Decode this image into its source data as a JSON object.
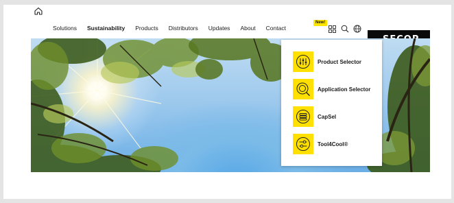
{
  "nav": {
    "home_icon": "home-icon",
    "links": [
      {
        "label": "Solutions",
        "active": false
      },
      {
        "label": "Sustainability",
        "active": true
      },
      {
        "label": "Products",
        "active": false
      },
      {
        "label": "Distributors",
        "active": false
      },
      {
        "label": "Updates",
        "active": false
      },
      {
        "label": "About",
        "active": false
      },
      {
        "label": "Contact",
        "active": false
      }
    ],
    "new_badge": "New!",
    "grid_icon": "grid-apps-icon",
    "search_icon": "search-icon",
    "globe_icon": "globe-icon"
  },
  "brand": {
    "logo_text": "SECOP"
  },
  "apps_menu": {
    "items": [
      {
        "label": "Product Selector",
        "icon": "sliders-icon"
      },
      {
        "label": "Application Selector",
        "icon": "target-search-icon"
      },
      {
        "label": "CapSel",
        "icon": "stack-icon"
      },
      {
        "label": "Tool4Cool®",
        "icon": "toggles-icon"
      }
    ]
  },
  "colors": {
    "accent": "#ffe000",
    "logo_bg": "#0a0a0a",
    "text": "#1a1a1a"
  }
}
